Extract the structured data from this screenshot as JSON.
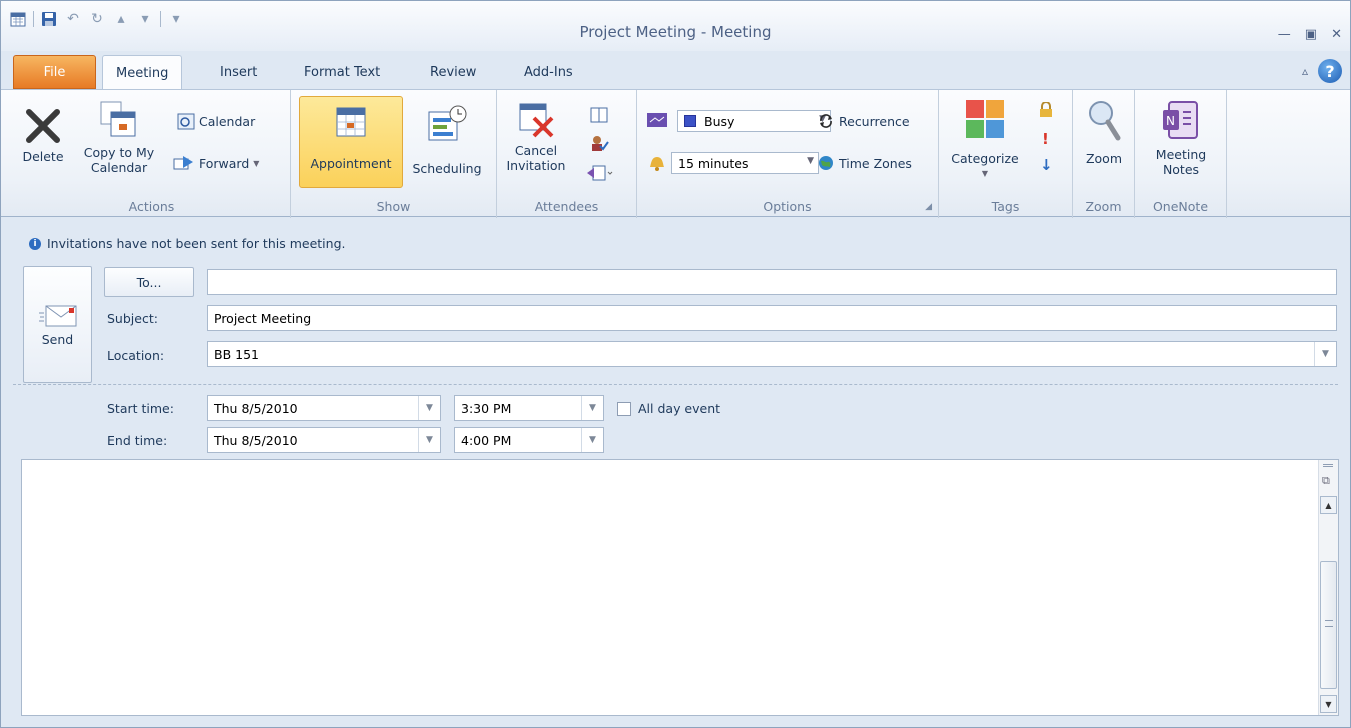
{
  "window": {
    "title": "Project Meeting  -  Meeting"
  },
  "tabs": [
    "File",
    "Meeting",
    "Insert",
    "Format Text",
    "Review",
    "Add-Ins"
  ],
  "ribbon": {
    "actions": {
      "label": "Actions",
      "delete": "Delete",
      "copy_line1": "Copy to My",
      "copy_line2": "Calendar",
      "calendar": "Calendar",
      "forward": "Forward"
    },
    "show": {
      "label": "Show",
      "appointment": "Appointment",
      "scheduling": "Scheduling"
    },
    "attendees": {
      "label": "Attendees",
      "cancel_line1": "Cancel",
      "cancel_line2": "Invitation"
    },
    "options": {
      "label": "Options",
      "show_as": "Busy",
      "reminder": "15 minutes",
      "recurrence": "Recurrence",
      "time_zones": "Time Zones"
    },
    "tags": {
      "label": "Tags",
      "categorize": "Categorize"
    },
    "zoom": {
      "label": "Zoom",
      "zoom": "Zoom"
    },
    "onenote": {
      "label": "OneNote",
      "notes_line1": "Meeting",
      "notes_line2": "Notes"
    }
  },
  "info": "Invitations have not been sent for this meeting.",
  "form": {
    "send": "Send",
    "to_button": "To...",
    "to_value": "",
    "subject_label": "Subject:",
    "subject_value": "Project Meeting",
    "location_label": "Location:",
    "location_value": "BB 151",
    "start_label": "Start time:",
    "start_date": "Thu 8/5/2010",
    "start_time": "3:30 PM",
    "end_label": "End time:",
    "end_date": "Thu 8/5/2010",
    "end_time": "4:00 PM",
    "all_day": "All day event"
  }
}
